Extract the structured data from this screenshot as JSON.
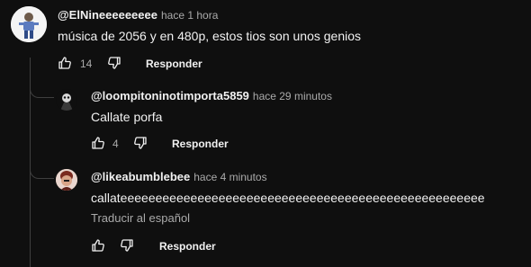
{
  "comments": [
    {
      "handle": "@ElNineeeeeeeee",
      "time": "hace 1 hora",
      "text": "música de 2056 y en 480p, estos tios son unos genios",
      "likes": "14",
      "reply_label": "Responder"
    },
    {
      "handle": "@loompitoninotimporta5859",
      "time": "hace 29 minutos",
      "text": "Callate porfa",
      "likes": "4",
      "reply_label": "Responder"
    },
    {
      "handle": "@likeabumblebee",
      "time": "hace 4 minutos",
      "text": "callateeeeeeeeeeeeeeeeeeeeeeeeeeeeeeeeeeeeeeeeeeeeeeeeeeee",
      "translate_label": "Traducir al español",
      "reply_label": "Responder"
    }
  ],
  "colors": {
    "background": "#0f0f0f",
    "text": "#f1f1f1",
    "muted": "#aaaaaa",
    "thread_line": "#3f3f3f"
  },
  "icons": {
    "like": "thumb-up-icon",
    "dislike": "thumb-down-icon"
  }
}
